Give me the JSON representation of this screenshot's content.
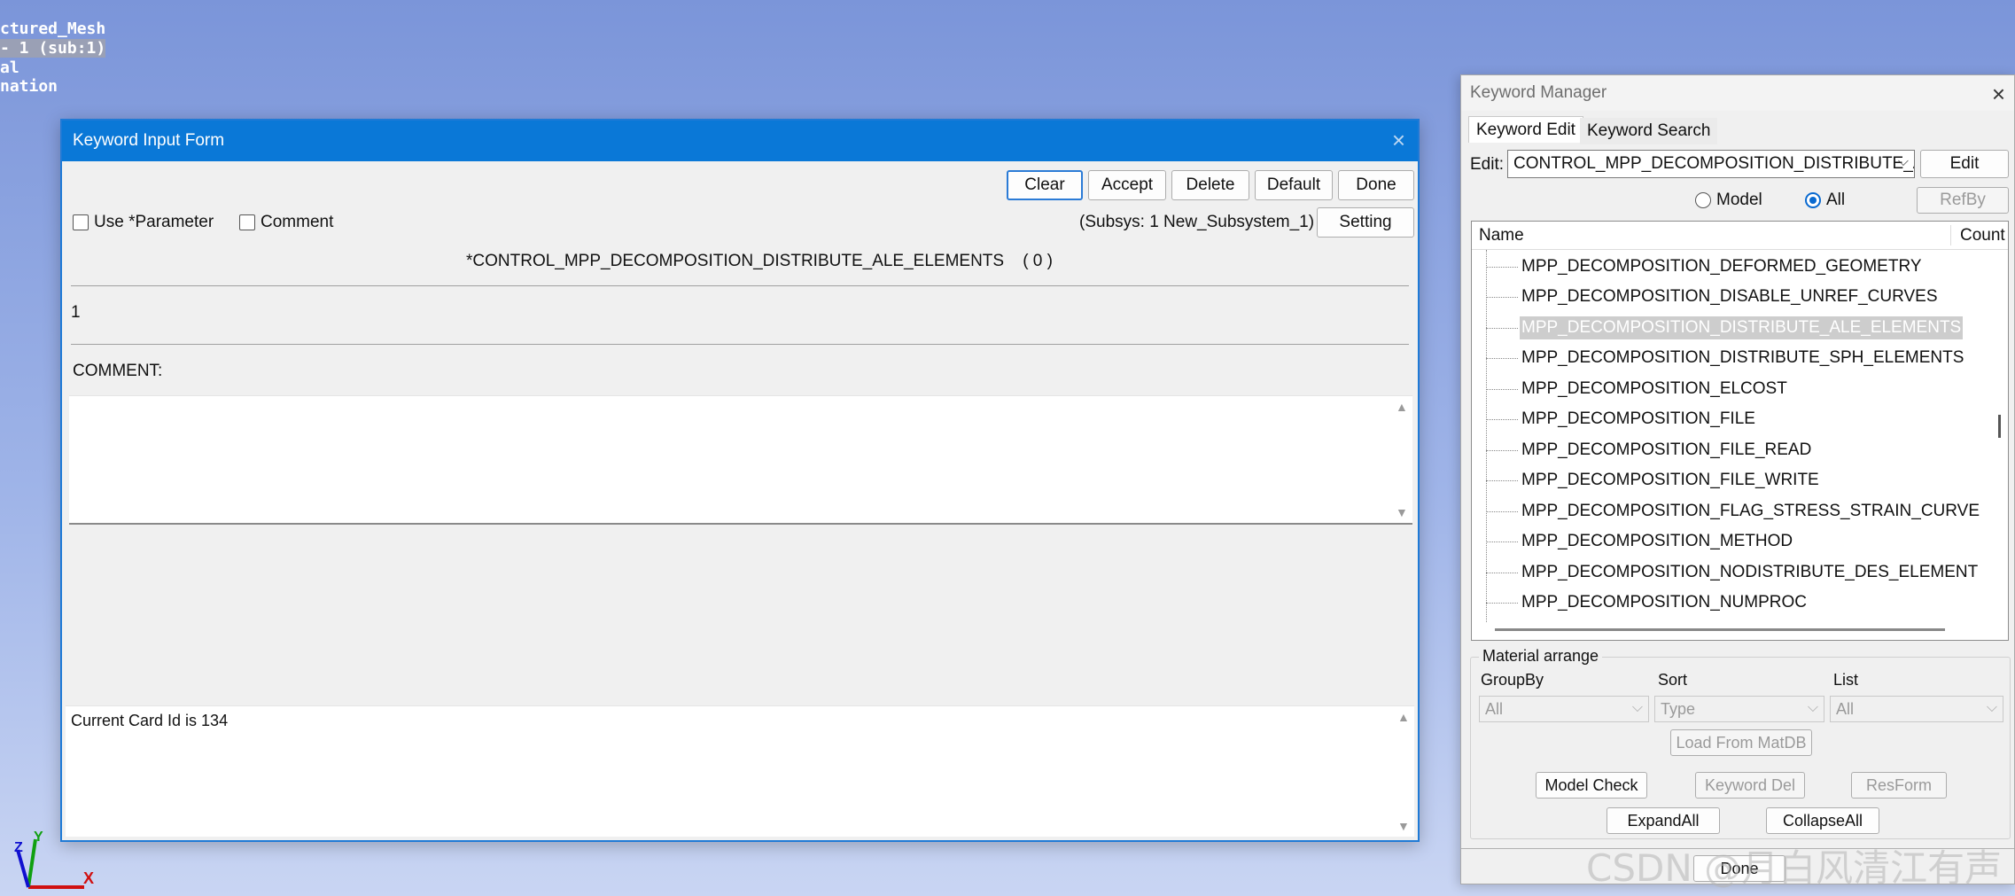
{
  "background_text": [
    "ctured_Mesh",
    "- 1 (sub:1)",
    "al",
    "nation"
  ],
  "keyword_input_form": {
    "title": "Keyword Input Form",
    "close": "×",
    "buttons": {
      "clear": "Clear",
      "accept": "Accept",
      "delete": "Delete",
      "default": "Default",
      "done": "Done",
      "setting": "Setting"
    },
    "use_parameter_label": "Use *Parameter",
    "comment_check_label": "Comment",
    "subsys_text": "(Subsys: 1 New_Subsystem_1)",
    "keyword_heading": "*CONTROL_MPP_DECOMPOSITION_DISTRIBUTE_ALE_ELEMENTS    ( 0 )",
    "card_value": "1",
    "comment_label": "COMMENT:",
    "comment_text": "",
    "status_text": "Current Card Id is 134"
  },
  "keyword_manager": {
    "title": "Keyword Manager",
    "close": "×",
    "tabs": [
      "Keyword Edit",
      "Keyword Search"
    ],
    "edit_label": "Edit:",
    "edit_value": "CONTROL_MPP_DECOMPOSITION_DISTRIBUTE_AI",
    "edit_button": "Edit",
    "radio_model": "Model",
    "radio_all": "All",
    "refby_button": "RefBy",
    "columns": {
      "name": "Name",
      "count": "Count"
    },
    "tree_items": [
      "MPP_DECOMPOSITION_DEFORMED_GEOMETRY",
      "MPP_DECOMPOSITION_DISABLE_UNREF_CURVES",
      "MPP_DECOMPOSITION_DISTRIBUTE_ALE_ELEMENTS",
      "MPP_DECOMPOSITION_DISTRIBUTE_SPH_ELEMENTS",
      "MPP_DECOMPOSITION_ELCOST",
      "MPP_DECOMPOSITION_FILE",
      "MPP_DECOMPOSITION_FILE_READ",
      "MPP_DECOMPOSITION_FILE_WRITE",
      "MPP_DECOMPOSITION_FLAG_STRESS_STRAIN_CURVE",
      "MPP_DECOMPOSITION_METHOD",
      "MPP_DECOMPOSITION_NODISTRIBUTE_DES_ELEMENT",
      "MPP_DECOMPOSITION_NUMPROC"
    ],
    "selected_item": "MPP_DECOMPOSITION_DISTRIBUTE_ALE_ELEMENTS",
    "material_arrange": {
      "title": "Material arrange",
      "groupby_label": "GroupBy",
      "sort_label": "Sort",
      "list_label": "List",
      "groupby_value": "All",
      "sort_value": "Type",
      "list_value": "All",
      "load_button": "Load From MatDB"
    },
    "buttons": {
      "model_check": "Model Check",
      "keyword_del": "Keyword Del",
      "resform": "ResForm",
      "expand_all": "ExpandAll",
      "collapse_all": "CollapseAll",
      "done": "Done"
    }
  },
  "axis_labels": {
    "x": "X",
    "y": "Y",
    "z": "Z"
  },
  "watermark": "CSDN @月白风清江有声"
}
